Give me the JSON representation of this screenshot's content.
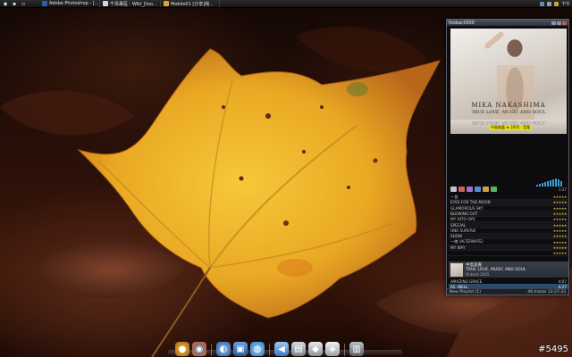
{
  "top_panel": {
    "tasks": [
      {
        "label": "Adobe Photoshop - [...",
        "color": "#2a5fa8"
      },
      {
        "label": "千鳥專區 - Wiki_[too...",
        "color": "#c8d8f0"
      },
      {
        "label": "Mobile01 [分享]我...",
        "color": "#e8a030"
      }
    ],
    "clock": "下午"
  },
  "foobar": {
    "title": "foobar2000",
    "artist": "MIKA NAKASHIMA",
    "album": "TRUE LOVE, MUSIC AND SOUL",
    "album_reflection": "TRUE LOVE, MUSIC AND SOUL",
    "label_text": "中島美嘉 ★ 2005 · 音樂",
    "time": "3:37",
    "tracks": [
      {
        "title": "一首",
        "rating": "★★★★★"
      },
      {
        "title": "EYES FOR THE MOON",
        "rating": "★★★★★"
      },
      {
        "title": "GLAMOROUS SKY",
        "rating": "★★★★★"
      },
      {
        "title": "BLOWING OUT",
        "rating": "★★★★★"
      },
      {
        "title": "MY HITO-OYE",
        "rating": "★★★★★"
      },
      {
        "title": "SPECIAL",
        "rating": "★★★★★"
      },
      {
        "title": "ONE SURVIVE",
        "rating": "★★★★★"
      },
      {
        "title": "SHOW",
        "rating": "★★★★★"
      },
      {
        "title": "一緒 (ALTERNATE)",
        "rating": "★★★★★"
      },
      {
        "title": "MY WAY",
        "rating": "★★★★★"
      },
      {
        "title": "",
        "rating": "★★★★★"
      }
    ],
    "now_playing": {
      "line1": "中島美嘉",
      "line2": "TRUE LOVE, MUSIC AND SOUL",
      "line3": "Ontario 2005"
    },
    "queue": [
      {
        "title": "AMAZING GRACE",
        "time": "4:07"
      },
      {
        "title": "01. WELL",
        "time": "4:27"
      }
    ],
    "status_left": "New Playlist (1)",
    "status_right": "46 tracks  13:37:33"
  },
  "dock": {
    "items": [
      {
        "icon": "circle-icon",
        "glyph": "●",
        "color": "#d89a20"
      },
      {
        "icon": "firefox-icon",
        "glyph": "◉",
        "color": "#e06a1a"
      },
      {
        "icon": "browser-icon",
        "glyph": "◐",
        "color": "#3a7ad0"
      },
      {
        "icon": "monitor-icon",
        "glyph": "▣",
        "color": "#4a8ad8"
      },
      {
        "icon": "globe-icon",
        "glyph": "◍",
        "color": "#3aa0e0"
      },
      {
        "icon": "arrow-icon",
        "glyph": "◀",
        "color": "#5aa0e8"
      },
      {
        "icon": "drive-icon",
        "glyph": "▤",
        "color": "#a8b0b8"
      },
      {
        "icon": "music-icon",
        "glyph": "◆",
        "color": "#c8d0d8"
      },
      {
        "icon": "disc-icon",
        "glyph": "◈",
        "color": "#d0d8e0"
      },
      {
        "icon": "trash-icon",
        "glyph": "▥",
        "color": "#8a9098"
      }
    ]
  },
  "watermark": "#5495"
}
